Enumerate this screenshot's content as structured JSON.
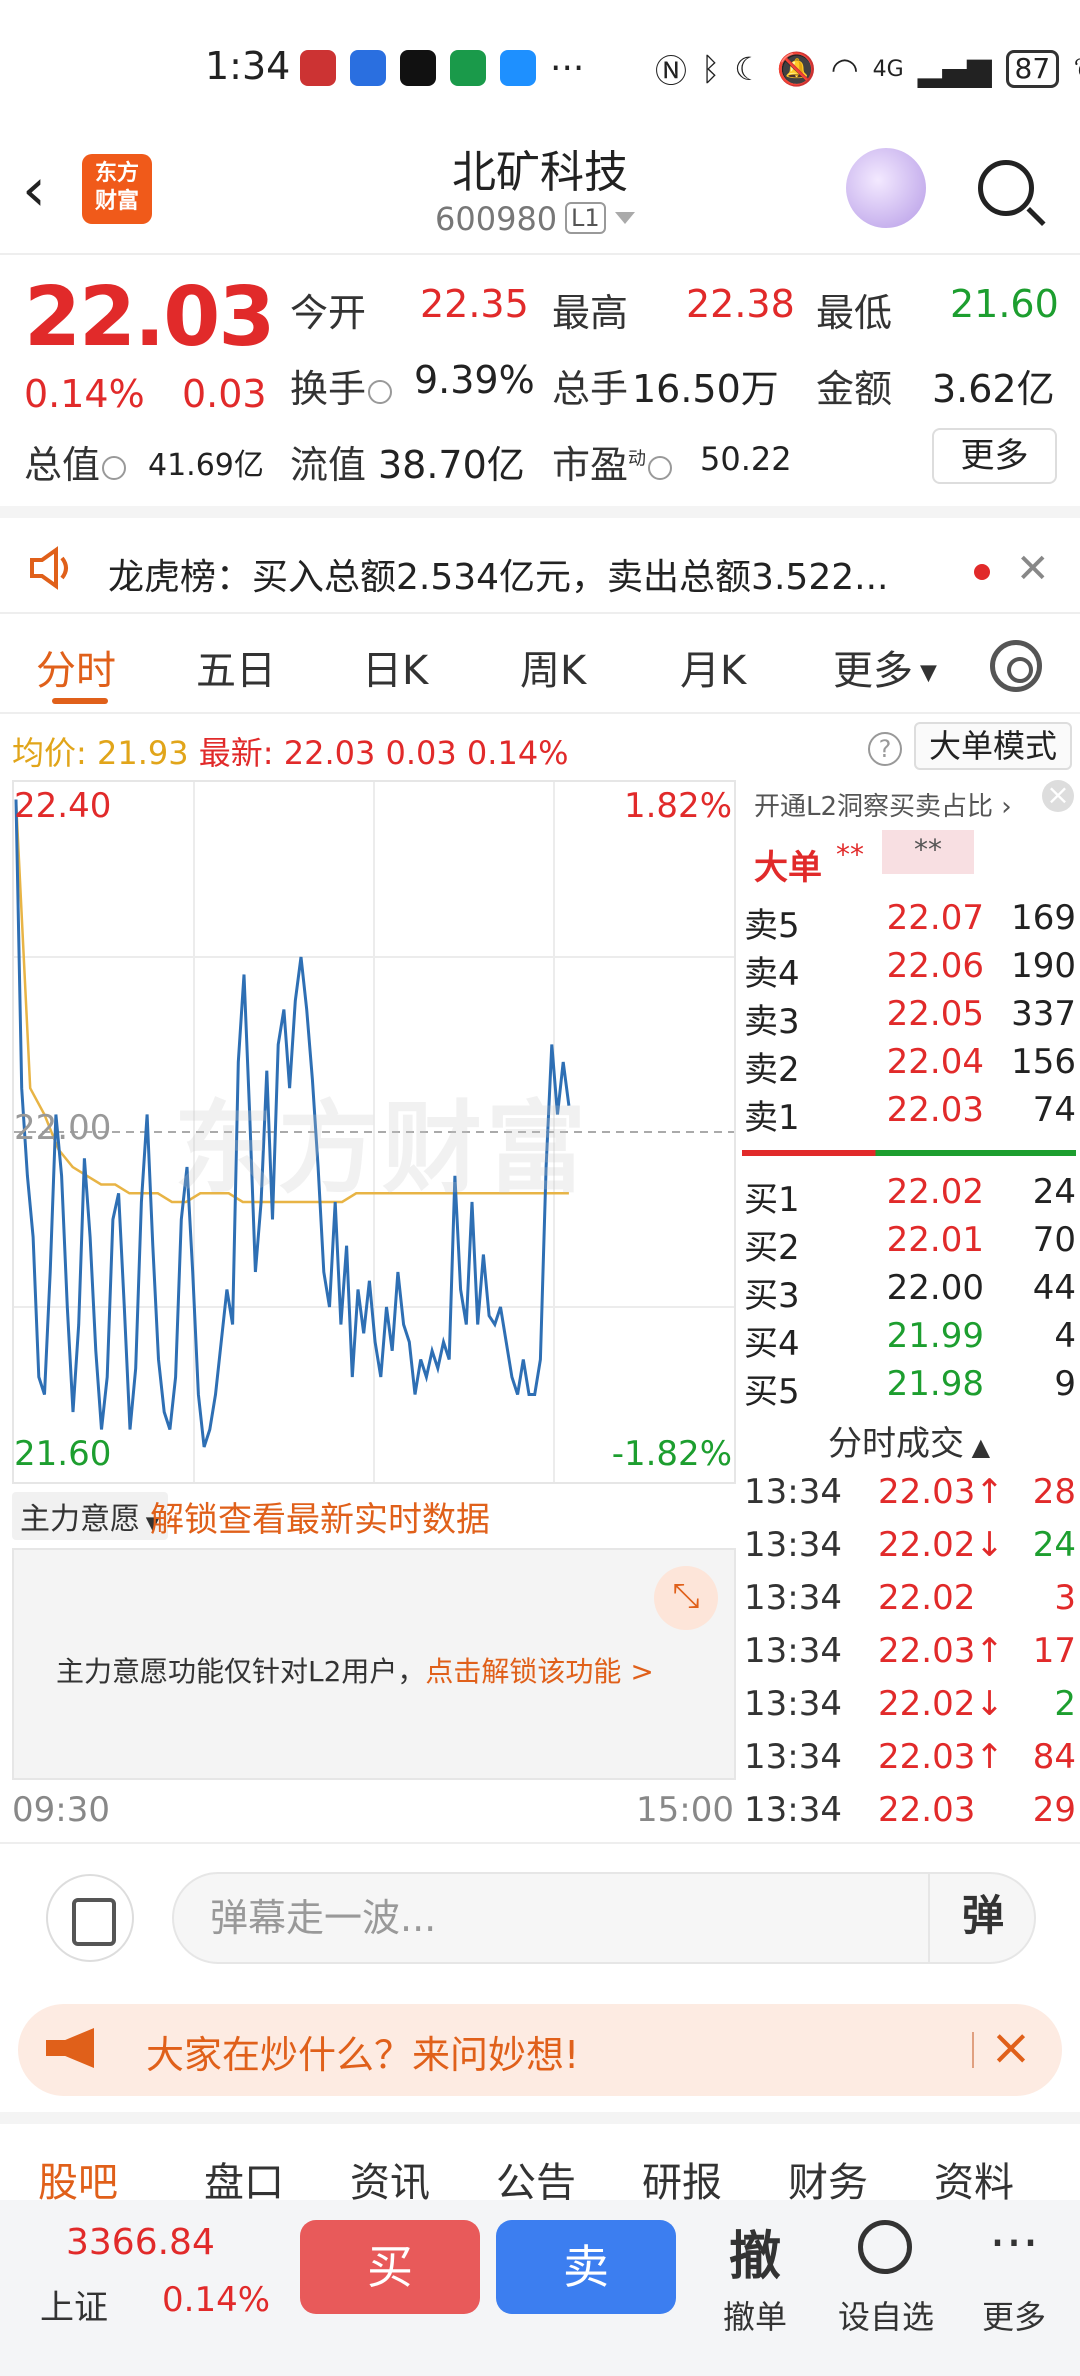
{
  "status": {
    "time": "1:34",
    "more": "···",
    "battery": "87",
    "net": "4G"
  },
  "header": {
    "logo_text": "东方\n财富",
    "title": "北矿科技",
    "code": "600980",
    "level": "L1"
  },
  "quote": {
    "price": "22.03",
    "change_pct": "0.14%",
    "change_amt": "0.03",
    "open_label": "今开",
    "open": "22.35",
    "high_label": "最高",
    "high": "22.38",
    "low_label": "最低",
    "low": "21.60",
    "turnover_label": "换手",
    "turnover": "9.39%",
    "volume_label": "总手",
    "volume": "16.50万",
    "amount_label": "金额",
    "amount": "3.62亿",
    "mktcap_label": "总值",
    "mktcap": "41.69亿",
    "float_label": "流值",
    "float": "38.70亿",
    "pe_label": "市盈",
    "pe_sup": "动",
    "pe": "50.22",
    "more": "更多"
  },
  "ticker": {
    "text": "龙虎榜：买入总额2.534亿元，卖出总额3.522..."
  },
  "tabs": [
    "分时",
    "五日",
    "日K",
    "周K",
    "月K",
    "更多"
  ],
  "info": {
    "avg_label": "均价:",
    "avg": "21.93",
    "latest_label": "最新:",
    "latest": "22.03",
    "chg": "0.03",
    "chg_pct": "0.14%",
    "big_order_mode": "大单模式"
  },
  "chart": {
    "y_top": "22.40",
    "y_mid": "22.00",
    "y_bottom": "21.60",
    "pct_top": "1.82%",
    "pct_bottom": "-1.82%",
    "watermark": "东方财富",
    "time_start": "09:30",
    "time_end": "15:00"
  },
  "chart_data": {
    "type": "line",
    "title": "",
    "xlabel": "",
    "ylabel": "",
    "ylim": [
      21.6,
      22.4
    ],
    "x_range": [
      "09:30",
      "15:00"
    ],
    "grid": true,
    "series": [
      {
        "name": "",
        "color": "#2e6fb4",
        "values": [
          22.38,
          22.05,
          21.95,
          21.88,
          21.72,
          21.7,
          21.84,
          22.02,
          21.95,
          21.8,
          21.68,
          21.78,
          21.97,
          21.88,
          21.75,
          21.66,
          21.72,
          21.9,
          21.93,
          21.8,
          21.66,
          21.73,
          21.92,
          22.02,
          21.87,
          21.74,
          21.68,
          21.66,
          21.72,
          21.9,
          21.96,
          21.84,
          21.7,
          21.64,
          21.66,
          21.7,
          21.76,
          21.82,
          21.78,
          22.08,
          22.18,
          22.02,
          21.84,
          21.92,
          22.07,
          21.9,
          22.1,
          22.14,
          22.05,
          22.15,
          22.2,
          22.14,
          22.06,
          21.96,
          21.84,
          21.8,
          21.92,
          21.78,
          21.87,
          21.72,
          21.82,
          21.77,
          21.83,
          21.76,
          21.72,
          21.8,
          21.75,
          21.84,
          21.78,
          21.76,
          21.7,
          21.74,
          21.72,
          21.75,
          21.73,
          21.76,
          21.74,
          21.95,
          21.82,
          21.78,
          21.92,
          21.78,
          21.86,
          21.79,
          21.78,
          21.8,
          21.76,
          21.72,
          21.7,
          21.74,
          21.7,
          21.7,
          21.74,
          21.96,
          22.1,
          22.02,
          22.08,
          22.03
        ]
      },
      {
        "name": "",
        "color": "#e8b445",
        "values": [
          22.38,
          22.05,
          22.02,
          21.98,
          21.96,
          21.95,
          21.94,
          21.94,
          21.93,
          21.93,
          21.93,
          21.92,
          21.92,
          21.93,
          21.93,
          21.93,
          21.92,
          21.92,
          21.92,
          21.92,
          21.92,
          21.92,
          21.92,
          21.92,
          21.93,
          21.93,
          21.93,
          21.93,
          21.93,
          21.93,
          21.93,
          21.93,
          21.93,
          21.93,
          21.93,
          21.93,
          21.93,
          21.93,
          21.93,
          21.93
        ]
      }
    ]
  },
  "orderbook": {
    "header": "开通L2洞察买卖占比",
    "big_label": "大单",
    "big_stars": "**",
    "big_box": "**",
    "asks": [
      {
        "label": "卖5",
        "price": "22.07",
        "vol": "169",
        "color": "red"
      },
      {
        "label": "卖4",
        "price": "22.06",
        "vol": "190",
        "color": "red"
      },
      {
        "label": "卖3",
        "price": "22.05",
        "vol": "337",
        "color": "red"
      },
      {
        "label": "卖2",
        "price": "22.04",
        "vol": "156",
        "color": "red"
      },
      {
        "label": "卖1",
        "price": "22.03",
        "vol": "74",
        "color": "red"
      }
    ],
    "buy_ratio": 0.4,
    "bids": [
      {
        "label": "买1",
        "price": "22.02",
        "vol": "24",
        "color": "red"
      },
      {
        "label": "买2",
        "price": "22.01",
        "vol": "70",
        "color": "red"
      },
      {
        "label": "买3",
        "price": "22.00",
        "vol": "44",
        "color": "black"
      },
      {
        "label": "买4",
        "price": "21.99",
        "vol": "4",
        "color": "green"
      },
      {
        "label": "买5",
        "price": "21.98",
        "vol": "9",
        "color": "green"
      }
    ],
    "trades_title": "分时成交",
    "trades": [
      {
        "time": "13:34",
        "price": "22.03↑",
        "vol": "28",
        "pcolor": "red",
        "vcolor": "red"
      },
      {
        "time": "13:34",
        "price": "22.02↓",
        "vol": "24",
        "pcolor": "red",
        "vcolor": "green"
      },
      {
        "time": "13:34",
        "price": "22.02",
        "vol": "3",
        "pcolor": "red",
        "vcolor": "red"
      },
      {
        "time": "13:34",
        "price": "22.03↑",
        "vol": "17",
        "pcolor": "red",
        "vcolor": "red"
      },
      {
        "time": "13:34",
        "price": "22.02↓",
        "vol": "2",
        "pcolor": "red",
        "vcolor": "green"
      },
      {
        "time": "13:34",
        "price": "22.03↑",
        "vol": "84",
        "pcolor": "red",
        "vcolor": "red"
      },
      {
        "time": "13:34",
        "price": "22.03",
        "vol": "29",
        "pcolor": "red",
        "vcolor": "red"
      }
    ]
  },
  "mainforce": {
    "selector": "主力意愿",
    "link": "解锁查看最新实时数据",
    "panel_text": "主力意愿功能仅针对L2用户，",
    "panel_link": "点击解锁该功能 >"
  },
  "danmu": {
    "placeholder": "弹幕走一波...",
    "button": "弹"
  },
  "banner": {
    "text": "大家在炒什么？来问妙想!"
  },
  "bottom_tabs": [
    "股吧",
    "盘口",
    "资讯",
    "公告",
    "研报",
    "财务",
    "资料"
  ],
  "action_bar": {
    "index_value": "3366.84",
    "index_name": "上证",
    "index_change": "0.14%",
    "buy": "买",
    "sell": "卖",
    "cancel_icon": "撤",
    "cancel": "撤单",
    "watch": "设自选",
    "more_icon": "···",
    "more": "更多"
  }
}
